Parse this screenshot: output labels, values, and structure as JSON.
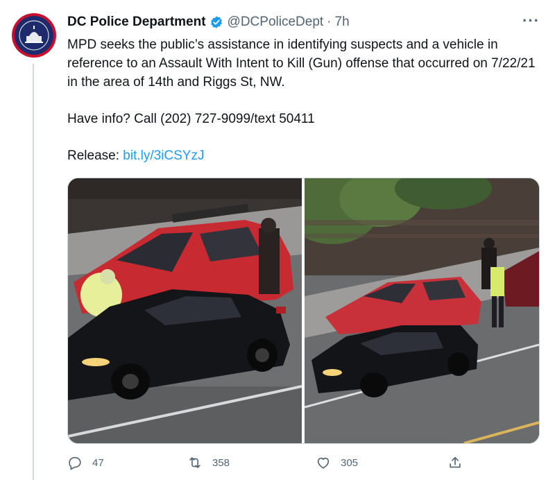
{
  "tweet": {
    "author_name": "DC Police Department",
    "handle": "@DCPoliceDept",
    "separator": "·",
    "time": "7h",
    "more_label": "···",
    "text_line_1": "MPD seeks the public’s assistance in identifying suspects and a vehicle in reference to an Assault With Intent to Kill (Gun) offense that occurred on 7/22/21 in the area of 14th and Riggs St, NW.",
    "text_line_2": "Have info? Call (202) 727-9099/text 50411",
    "release_label": "Release: ",
    "release_link": "bit.ly/3iCSYzJ",
    "media": [
      {
        "description_icon": "photo-suspects-red-car-close"
      },
      {
        "description_icon": "photo-suspects-street-wide"
      }
    ],
    "actions": {
      "replies": "47",
      "retweets": "358",
      "likes": "305"
    }
  },
  "colors": {
    "link": "#1d9bf0",
    "secondary_text": "#536471",
    "verified": "#1d9bf0",
    "avatar_ring": "#c8102e"
  },
  "icons": [
    "verified-badge-icon",
    "more-icon",
    "reply-icon",
    "retweet-icon",
    "like-icon",
    "share-icon"
  ]
}
